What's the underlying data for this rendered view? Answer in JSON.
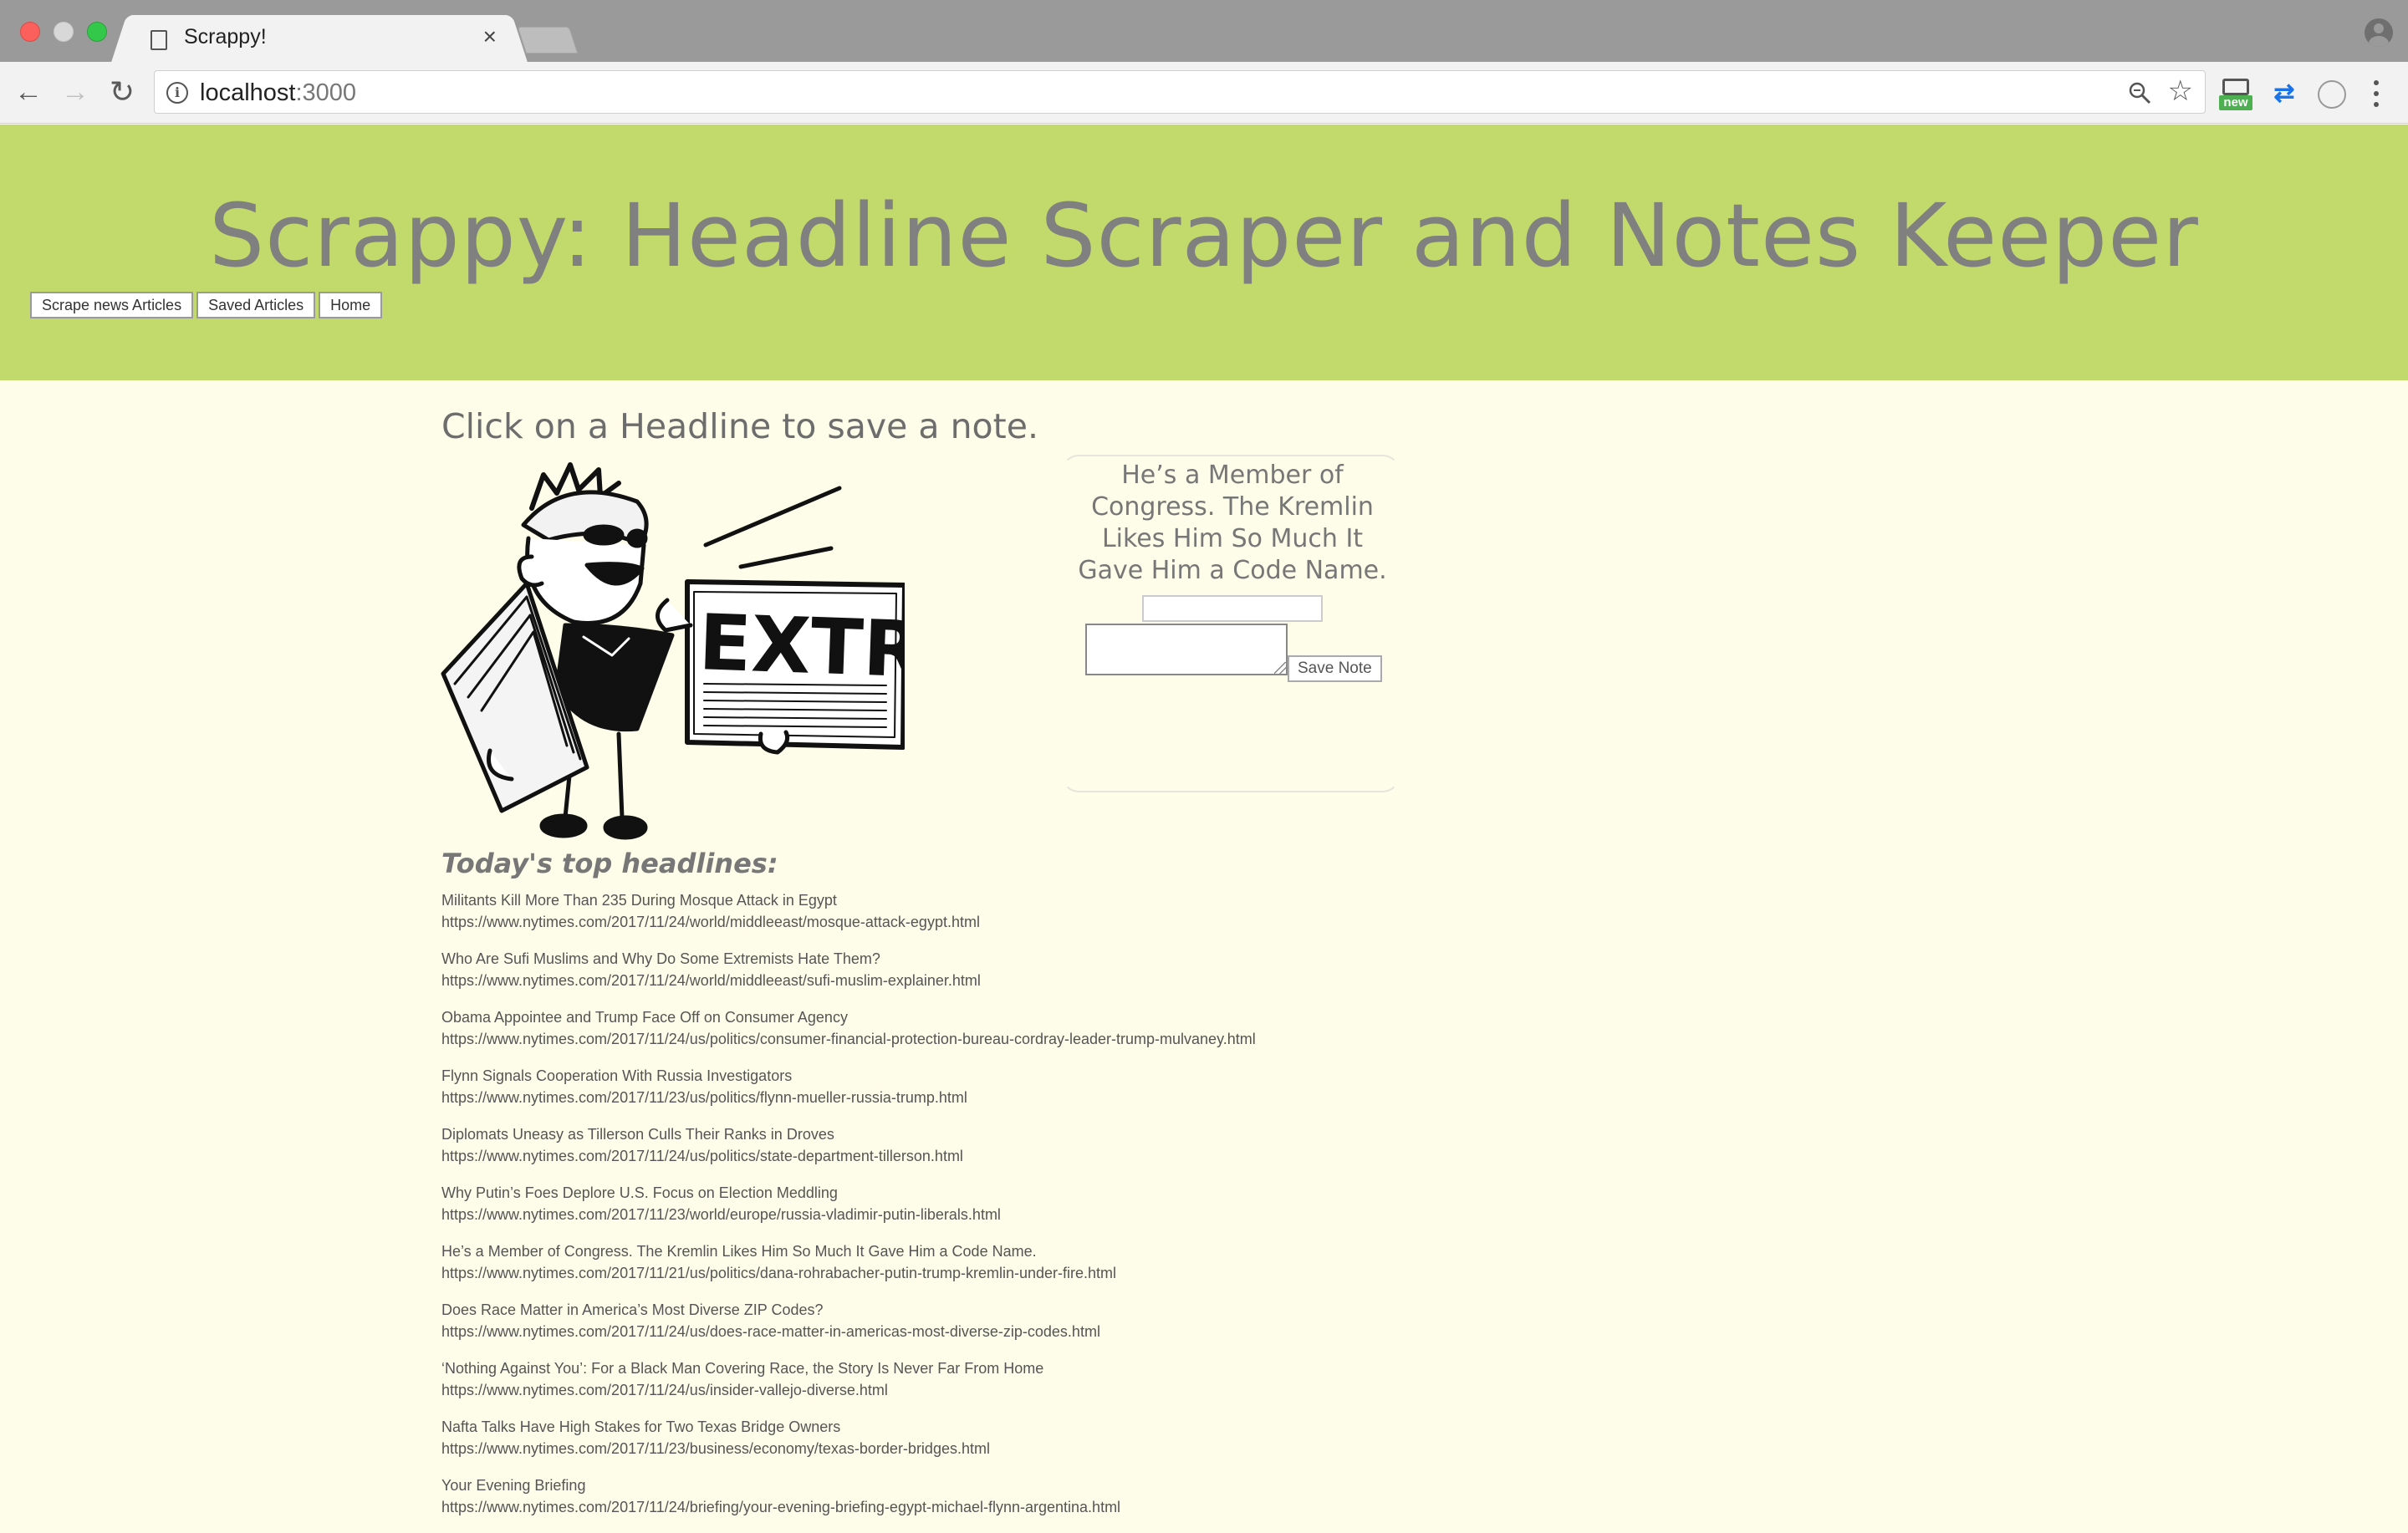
{
  "browser": {
    "tab_title": "Scrappy!",
    "tab_close": "×",
    "url_host": "localhost",
    "url_port": ":3000",
    "info_glyph": "i",
    "extension_badge": "new",
    "icons": [
      "back-arrow-icon",
      "forward-arrow-icon",
      "reload-icon",
      "info-icon",
      "zoom-icon",
      "star-icon",
      "new-extension-icon",
      "arrows-extension-icon",
      "circle-extension-icon",
      "menu-dots-icon",
      "profile-icon",
      "document-icon"
    ]
  },
  "header": {
    "title": "Scrappy: Headline Scraper and Notes Keeper",
    "nav": {
      "scrape": "Scrape news Articles",
      "saved": "Saved Articles",
      "home": "Home"
    },
    "background_color": "#c2d96b"
  },
  "main": {
    "lead": "Click on a Headline to save a note.",
    "illustration": {
      "sign_text": "EXTRA!"
    },
    "note": {
      "title": "He’s a Member of Congress. The Kremlin Likes Him So Much It Gave Him a Code Name.",
      "input_value": "",
      "textarea_value": "",
      "save_label": "Save Note"
    },
    "headlines_heading": "Today's top headlines:",
    "headlines": [
      {
        "title": "Militants Kill More Than 235 During Mosque Attack in Egypt",
        "url": "https://www.nytimes.com/2017/11/24/world/middleeast/mosque-attack-egypt.html"
      },
      {
        "title": "Who Are Sufi Muslims and Why Do Some Extremists Hate Them?",
        "url": "https://www.nytimes.com/2017/11/24/world/middleeast/sufi-muslim-explainer.html"
      },
      {
        "title": "Obama Appointee and Trump Face Off on Consumer Agency",
        "url": "https://www.nytimes.com/2017/11/24/us/politics/consumer-financial-protection-bureau-cordray-leader-trump-mulvaney.html"
      },
      {
        "title": "Flynn Signals Cooperation With Russia Investigators",
        "url": "https://www.nytimes.com/2017/11/23/us/politics/flynn-mueller-russia-trump.html"
      },
      {
        "title": "Diplomats Uneasy as Tillerson Culls Their Ranks in Droves",
        "url": "https://www.nytimes.com/2017/11/24/us/politics/state-department-tillerson.html"
      },
      {
        "title": "Why Putin’s Foes Deplore U.S. Focus on Election Meddling",
        "url": "https://www.nytimes.com/2017/11/23/world/europe/russia-vladimir-putin-liberals.html"
      },
      {
        "title": "He’s a Member of Congress. The Kremlin Likes Him So Much It Gave Him a Code Name.",
        "url": "https://www.nytimes.com/2017/11/21/us/politics/dana-rohrabacher-putin-trump-kremlin-under-fire.html"
      },
      {
        "title": "Does Race Matter in America’s Most Diverse ZIP Codes?",
        "url": "https://www.nytimes.com/2017/11/24/us/does-race-matter-in-americas-most-diverse-zip-codes.html"
      },
      {
        "title": "‘Nothing Against You’: For a Black Man Covering Race, the Story Is Never Far From Home",
        "url": "https://www.nytimes.com/2017/11/24/us/insider-vallejo-diverse.html"
      },
      {
        "title": "Nafta Talks Have High Stakes for Two Texas Bridge Owners",
        "url": "https://www.nytimes.com/2017/11/23/business/economy/texas-border-bridges.html"
      },
      {
        "title": "Your Evening Briefing",
        "url": "https://www.nytimes.com/2017/11/24/briefing/your-evening-briefing-egypt-michael-flynn-argentina.html"
      }
    ]
  }
}
